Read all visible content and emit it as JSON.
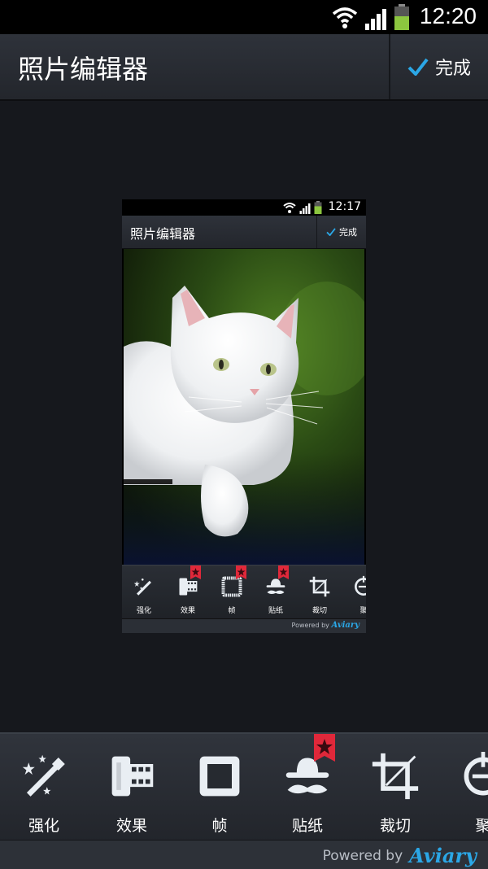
{
  "status_bar": {
    "time": "12:20",
    "icons": [
      "wifi-icon",
      "signal-icon",
      "battery-icon"
    ]
  },
  "action_bar": {
    "title": "照片编辑器",
    "done_label": "完成",
    "done_icon": "checkmark-icon"
  },
  "preview": {
    "status_time": "12:17",
    "title": "照片编辑器",
    "done_label": "完成",
    "tools": [
      {
        "label": "强化",
        "icon": "magic-wand-icon",
        "badge": false
      },
      {
        "label": "效果",
        "icon": "film-roll-icon",
        "badge": true
      },
      {
        "label": "帧",
        "icon": "frame-icon",
        "badge": true
      },
      {
        "label": "贴纸",
        "icon": "hat-mustache-icon",
        "badge": true
      },
      {
        "label": "裁切",
        "icon": "crop-icon",
        "badge": false
      },
      {
        "label": "聚",
        "icon": "focus-icon",
        "badge": false
      }
    ],
    "footer_powered": "Powered by",
    "footer_brand": "Aviary"
  },
  "toolbar": {
    "tools": [
      {
        "label": "强化",
        "icon": "magic-wand-icon",
        "badge": false
      },
      {
        "label": "效果",
        "icon": "film-roll-icon",
        "badge": false
      },
      {
        "label": "帧",
        "icon": "frame-icon",
        "badge": false
      },
      {
        "label": "贴纸",
        "icon": "hat-mustache-icon",
        "badge": true
      },
      {
        "label": "裁切",
        "icon": "crop-icon",
        "badge": false
      },
      {
        "label": "聚",
        "icon": "focus-icon",
        "badge": false
      }
    ]
  },
  "footer": {
    "powered": "Powered by",
    "brand": "Aviary"
  },
  "colors": {
    "accent": "#2ba7e6",
    "badge": "#e0283a",
    "background": "#16181d",
    "bar": "#2a2e35"
  }
}
